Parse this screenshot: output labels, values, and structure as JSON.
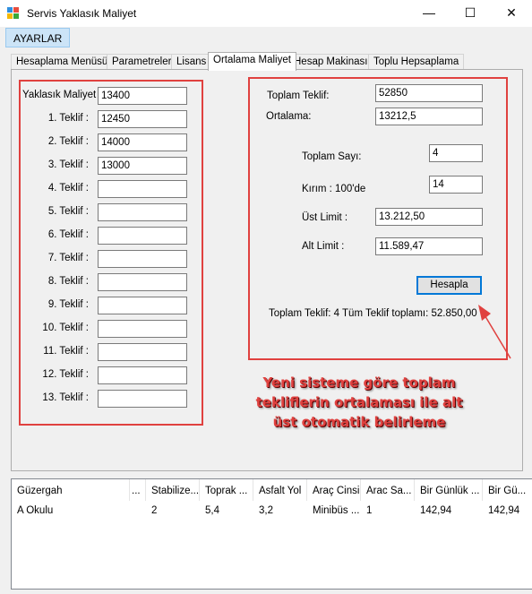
{
  "window": {
    "title": "Servis Yaklasık Maliyet",
    "minimize": "—",
    "maximize": "☐",
    "close": "✕"
  },
  "menu": {
    "settings": "AYARLAR"
  },
  "tabs": [
    {
      "label": "Hesaplama Menüsü",
      "active": false
    },
    {
      "label": "Parametreler",
      "active": false
    },
    {
      "label": "Lisans",
      "active": false
    },
    {
      "label": "Ortalama Maliyet",
      "active": true
    },
    {
      "label": "Hesap Makinası",
      "active": false
    },
    {
      "label": "Toplu Hepsaplama",
      "active": false
    }
  ],
  "left_panel": {
    "approx_cost_label": "Yaklasık Maliyet",
    "approx_cost_value": "13400",
    "offers": [
      {
        "label": "1. Teklif :",
        "value": "12450"
      },
      {
        "label": "2. Teklif :",
        "value": "14000"
      },
      {
        "label": "3. Teklif :",
        "value": "13000"
      },
      {
        "label": "4. Teklif :",
        "value": ""
      },
      {
        "label": "5. Teklif :",
        "value": ""
      },
      {
        "label": "6. Teklif :",
        "value": ""
      },
      {
        "label": "7. Teklif :",
        "value": ""
      },
      {
        "label": "8. Teklif :",
        "value": ""
      },
      {
        "label": "9. Teklif :",
        "value": ""
      },
      {
        "label": "10. Teklif :",
        "value": ""
      },
      {
        "label": "11. Teklif :",
        "value": ""
      },
      {
        "label": "12. Teklif :",
        "value": ""
      },
      {
        "label": "13. Teklif :",
        "value": ""
      }
    ]
  },
  "right_panel": {
    "total_offer_label": "Toplam Teklif:",
    "total_offer_value": "52850",
    "average_label": "Ortalama:",
    "average_value": "13212,5",
    "total_count_label": "Toplam Sayı:",
    "total_count_value": "4",
    "cut_label": "Kırım : 100'de",
    "cut_value": "14",
    "upper_limit_label": "Üst Limit :",
    "upper_limit_value": "13.212,50",
    "lower_limit_label": "Alt Limit :",
    "lower_limit_value": "11.589,47",
    "calculate_button": "Hesapla",
    "summary": "Toplam Teklif: 4 Tüm Teklif toplamı: 52.850,00"
  },
  "annotation": {
    "line1": "Yeni sisteme göre toplam",
    "line2": "tekliflerin ortalaması ile alt",
    "line3": "üst otomatik belirleme"
  },
  "table": {
    "columns": [
      "Güzergah",
      "...",
      "Stabilize...",
      "Toprak ...",
      "Asfalt Yol",
      "Araç Cinsi",
      "Arac Sa...",
      "Bir Günlük ...",
      "Bir Gü..."
    ],
    "rows": [
      [
        "A Okulu",
        "",
        "2",
        "5,4",
        "3,2",
        "Minibüs ...",
        "1",
        "142,94",
        "142,94"
      ]
    ]
  },
  "colors": {
    "highlight_red": "#e0413f",
    "button_border_blue": "#0078d7",
    "menu_highlight": "#cce4f7"
  }
}
